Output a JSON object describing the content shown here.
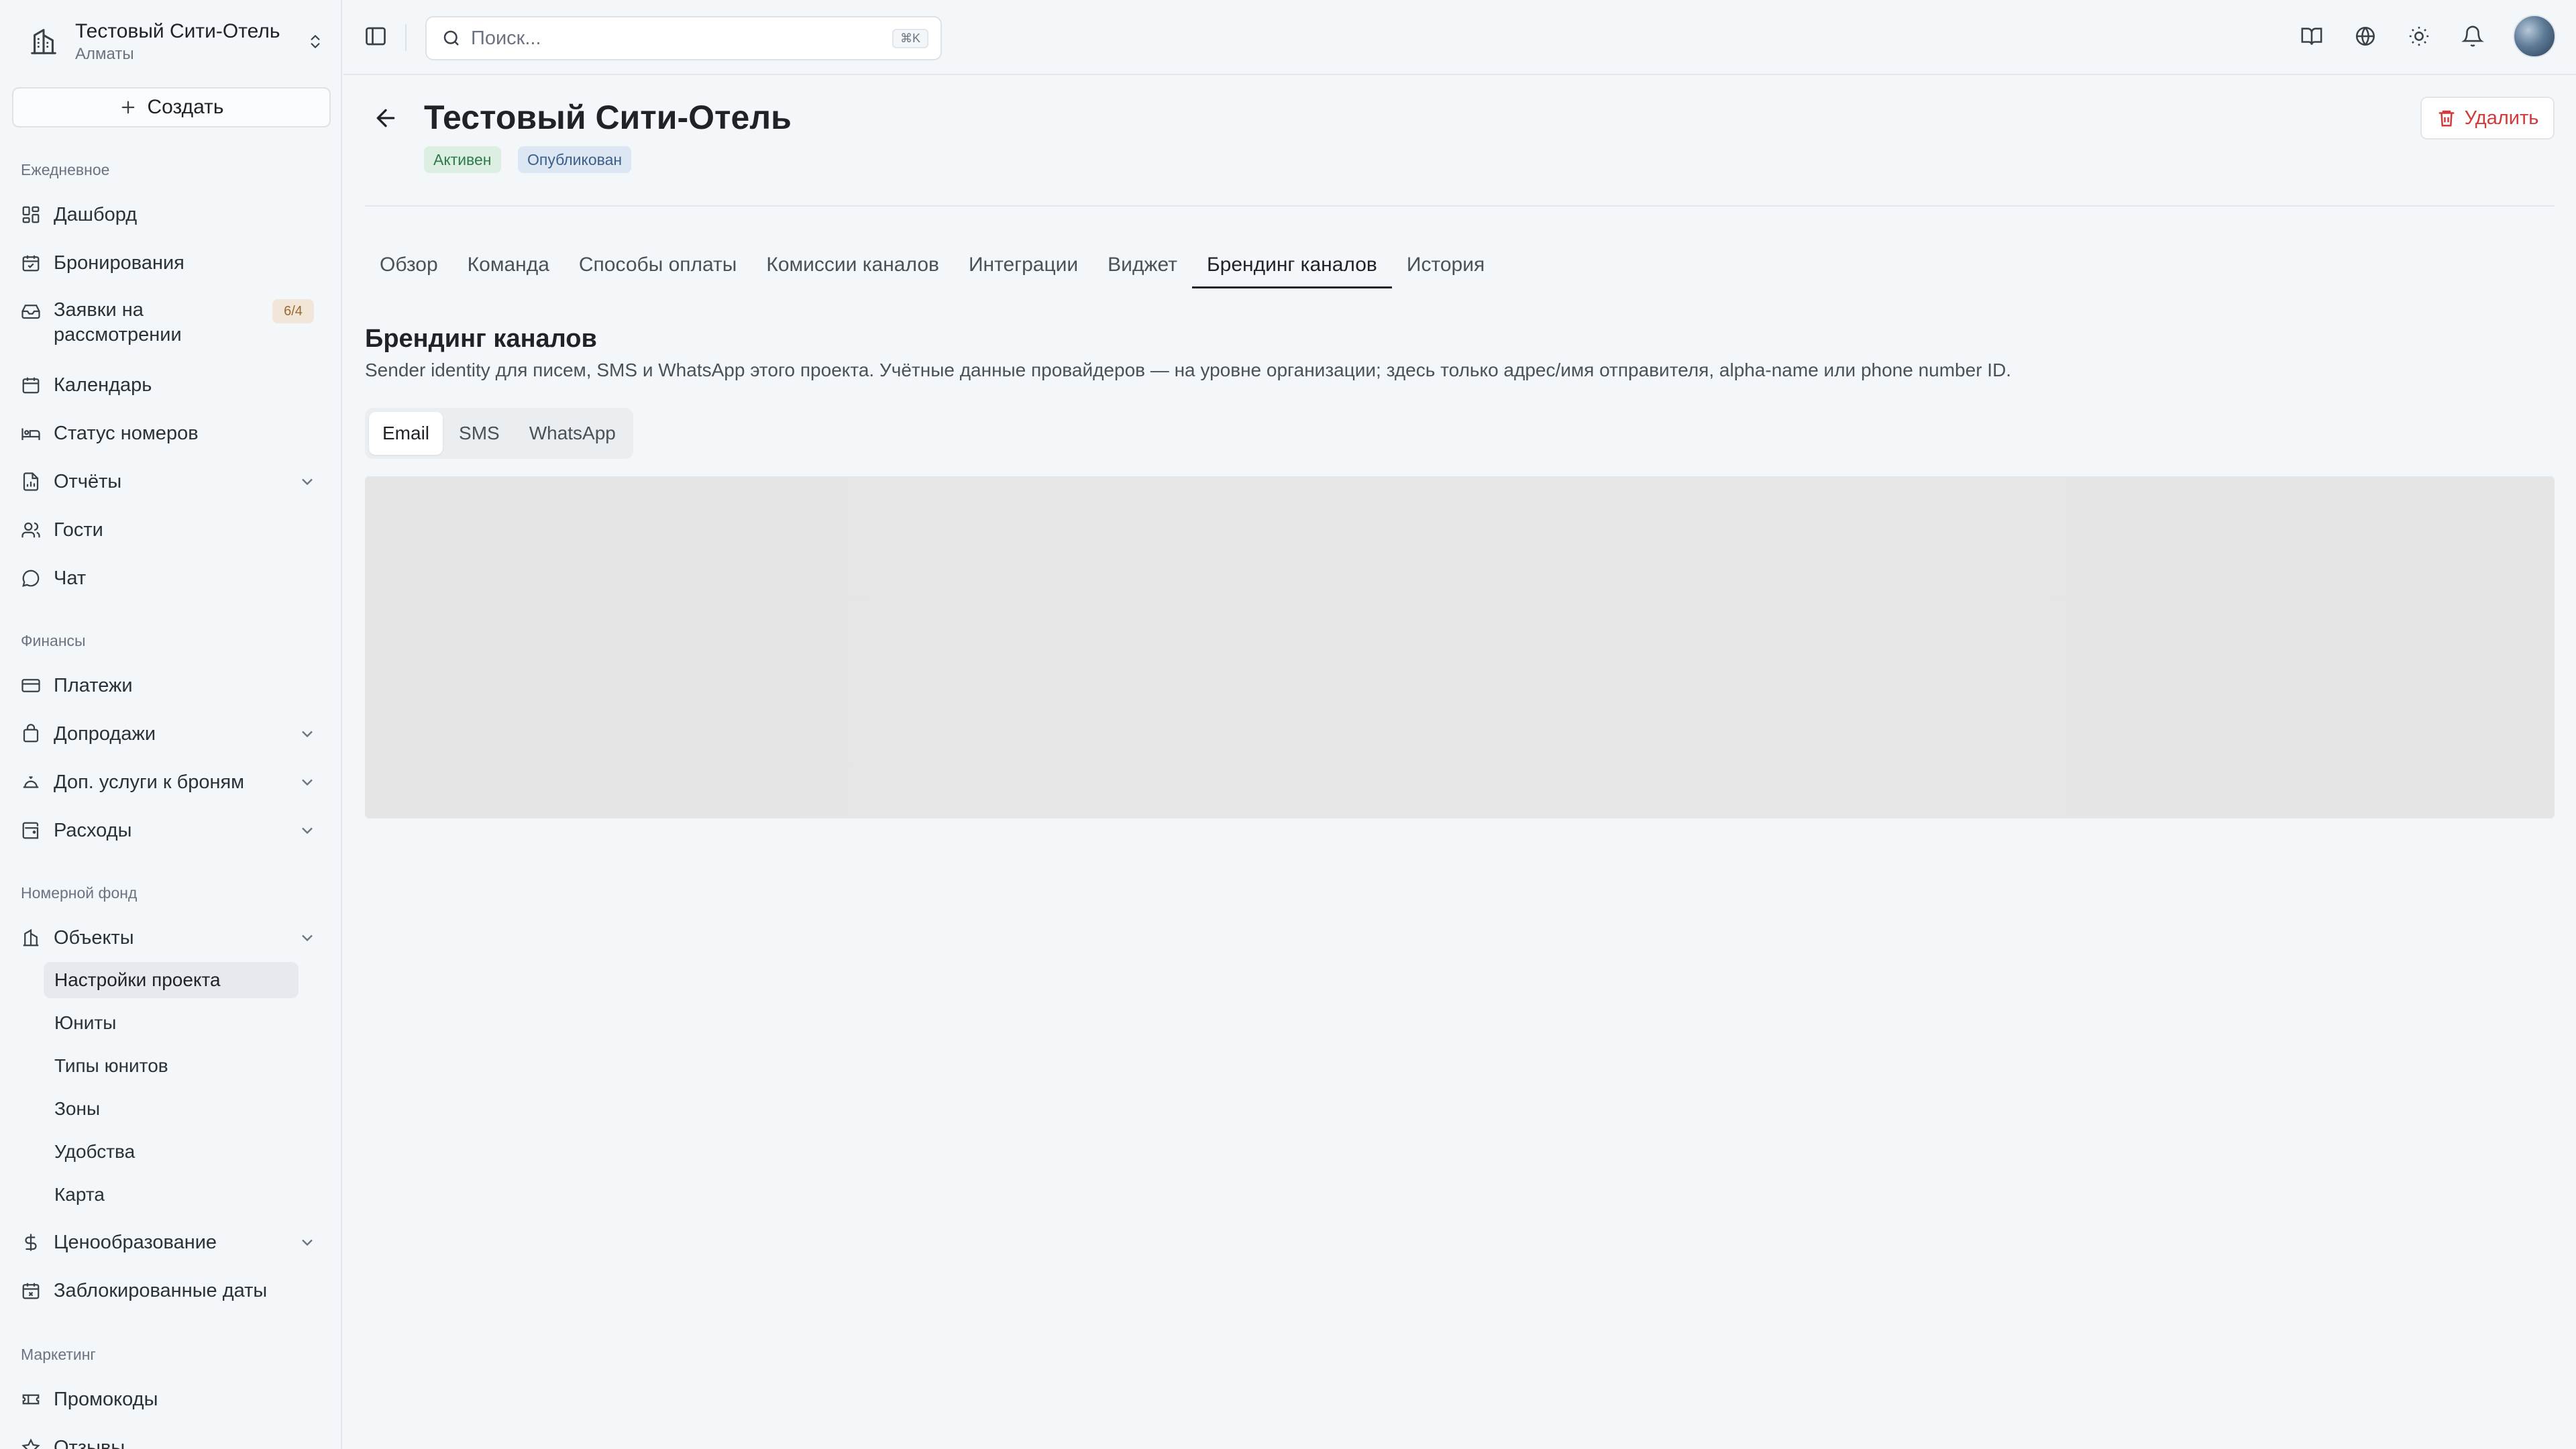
{
  "org": {
    "name": "Тестовый Сити-Отель",
    "city": "Алматы"
  },
  "sidebar": {
    "create_label": "Создать",
    "sections": {
      "daily": "Ежедневное",
      "finance": "Финансы",
      "rooms": "Номерной фонд",
      "marketing": "Маркетинг"
    },
    "items": {
      "dashboard": "Дашборд",
      "bookings": "Бронирования",
      "requests": "Заявки на рассмотрении",
      "requests_badge": "6/4",
      "calendar": "Календарь",
      "room_status": "Статус номеров",
      "reports": "Отчёты",
      "guests": "Гости",
      "chat": "Чат",
      "payments": "Платежи",
      "upsells": "Допродажи",
      "extra_services": "Доп. услуги к броням",
      "expenses": "Расходы",
      "objects": "Объекты",
      "project_settings": "Настройки проекта",
      "units": "Юниты",
      "unit_types": "Типы юнитов",
      "zones": "Зоны",
      "amenities": "Удобства",
      "map": "Карта",
      "pricing": "Ценообразование",
      "blocked_dates": "Заблокированные даты",
      "promocodes": "Промокоды",
      "reviews": "Отзывы"
    }
  },
  "search": {
    "placeholder": "Поиск...",
    "shortcut": "⌘K"
  },
  "page": {
    "title": "Тестовый Сити-Отель",
    "status_active": "Активен",
    "status_published": "Опубликован",
    "delete_label": "Удалить"
  },
  "tabs": [
    "Обзор",
    "Команда",
    "Способы оплаты",
    "Комиссии каналов",
    "Интеграции",
    "Виджет",
    "Брендинг каналов",
    "История"
  ],
  "branding": {
    "title": "Брендинг каналов",
    "description": "Sender identity для писем, SMS и WhatsApp этого проекта. Учётные данные провайдеров — на уровне организации; здесь только адрес/имя отправителя, alpha-name или phone number ID.",
    "channels": [
      "Email",
      "SMS",
      "WhatsApp"
    ]
  },
  "colors": {
    "accent_delete": "#d23a3a",
    "badge_active": "#2f7a4a",
    "badge_published": "#3a5f8a"
  }
}
